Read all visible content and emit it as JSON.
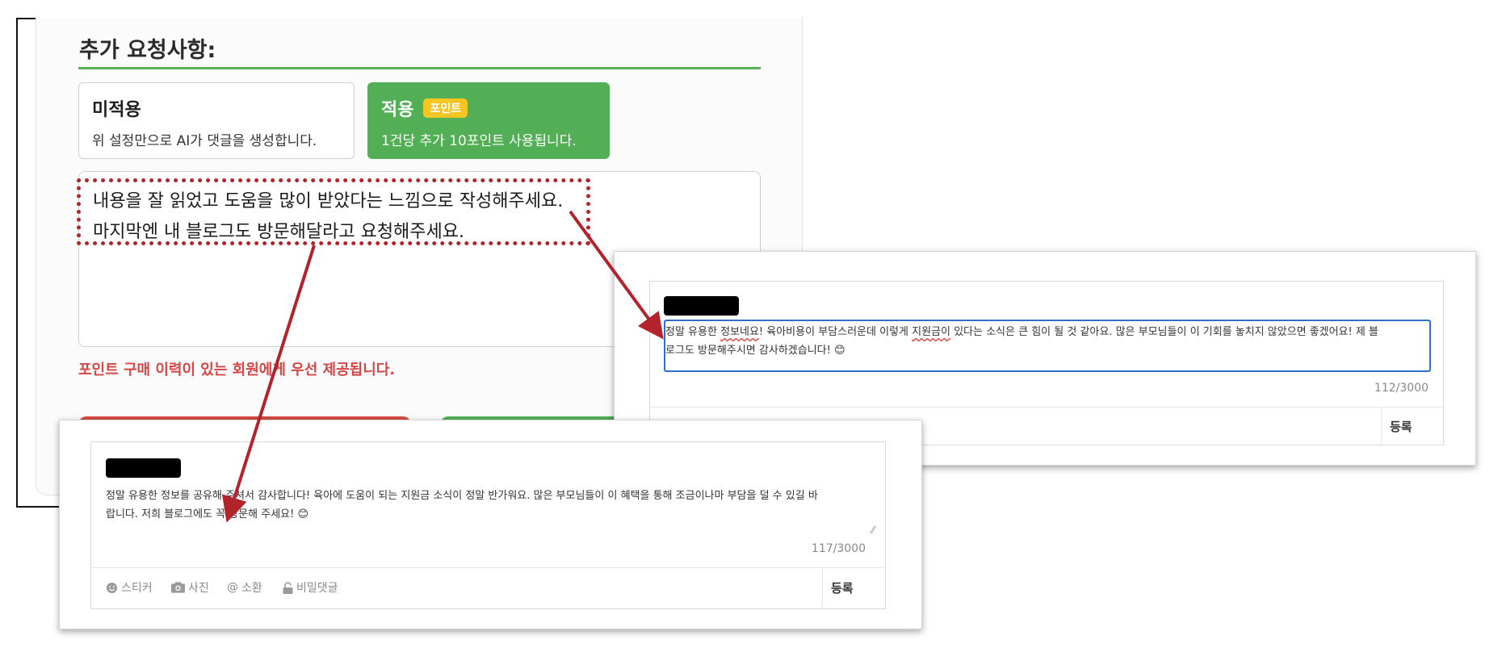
{
  "settings_panel": {
    "section_title": "추가 요청사항:",
    "option_off": {
      "title": "미적용",
      "description": "위 설정만으로 AI가 댓글을 생성합니다."
    },
    "option_on": {
      "title": "적용",
      "badge": "포인트",
      "description": "1건당 추가 10포인트 사용됩니다."
    },
    "request_lines": [
      "내용을 잘 읽었고 도움을 많이 받았다는 느낌으로 작성해주세요.",
      "마지막엔 내 블로그도 방문해달라고 요청해주세요."
    ],
    "notice": "포인트 구매 이력이 있는 회원에게 우선 제공됩니다."
  },
  "comment_right": {
    "line1_a": "정말 유용한 ",
    "line1_b": "정보네요",
    "line1_c": "! 육아비용이 부담스러운데 이렇게 ",
    "line1_d": "지원금이",
    "line1_e": " 있다는 소식은 큰 힘이 될 것 같아요. 많은 부모님들이 이 기회를 놓치지 않았으면 좋겠어요! 제 블",
    "line2": "로그도 방문해주시면 감사하겠습니다! 😊",
    "counter": "112/3000",
    "submit": "등록"
  },
  "comment_bottom": {
    "line1": "정말 유용한 정보를 공유해 주셔서 감사합니다! 육아에 도움이 되는 지원금 소식이 정말 반가워요. 많은 부모님들이 이 혜택을 통해 조금이나마 부담을 덜 수 있길 바",
    "line2": "랍니다. 저희 블로그에도 꼭 방문해 주세요! 😊",
    "counter": "117/3000",
    "submit": "등록",
    "tools": {
      "sticker": "스티커",
      "photo": "사진",
      "mention": "소환",
      "secret": "비밀댓글"
    }
  },
  "colors": {
    "accent_green": "#53af55",
    "alert_red": "#d94545",
    "highlight_red": "#b3232c",
    "badge_yellow": "#f5c623",
    "focus_blue": "#2f6fc9"
  },
  "icons": [
    "smile-icon",
    "camera-icon",
    "at-icon",
    "lock-icon",
    "resize-grip-icon"
  ]
}
